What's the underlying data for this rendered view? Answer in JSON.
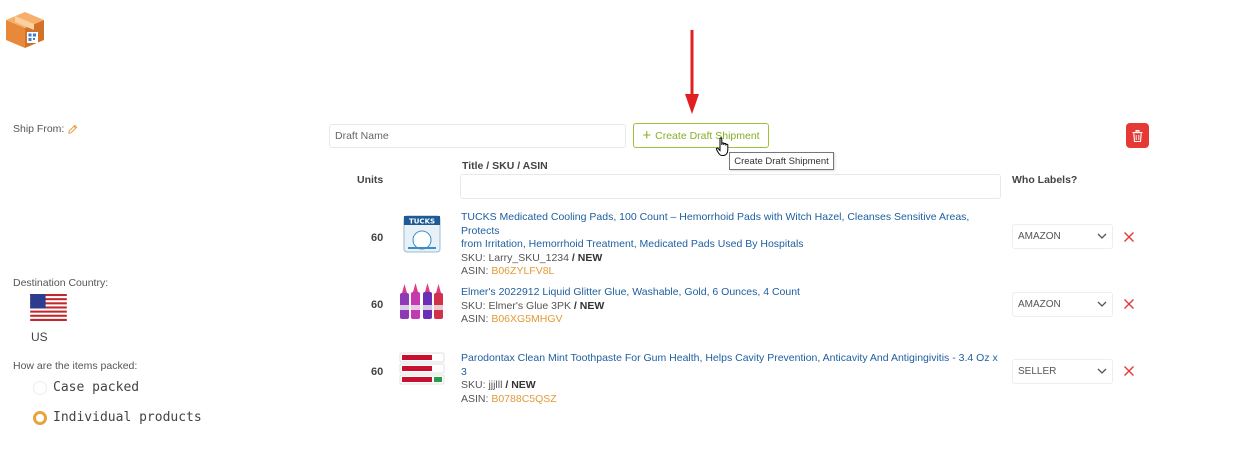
{
  "ship_from": {
    "label": "Ship From:"
  },
  "destination": {
    "label": "Destination Country:",
    "country_code": "US"
  },
  "packing": {
    "label": "How are the items packed:",
    "options": [
      {
        "label": "Case packed",
        "selected": false
      },
      {
        "label": "Individual products",
        "selected": true
      }
    ]
  },
  "draft": {
    "placeholder": "Draft Name",
    "create_label": "Create Draft Shipment",
    "tooltip": "Create Draft Shipment"
  },
  "table": {
    "headers": {
      "units": "Units",
      "title": "Title / SKU / ASIN",
      "who_labels": "Who Labels?"
    },
    "rows": [
      {
        "units": "60",
        "title_line1": "TUCKS Medicated Cooling Pads, 100 Count – Hemorrhoid Pads with Witch Hazel, Cleanses Sensitive Areas, Protects",
        "title_line2": "from Irritation, Hemorrhoid Treatment, Medicated Pads Used By Hospitals",
        "sku_prefix": "SKU: ",
        "sku": "Larry_SKU_1234",
        "condition": " / NEW",
        "asin_prefix": "ASIN: ",
        "asin": "B06ZYLFV8L",
        "who_labels": "AMAZON",
        "thumb_icon": "tucks-product-icon"
      },
      {
        "units": "60",
        "title_line1": "Elmer's 2022912 Liquid Glitter Glue, Washable, Gold, 6 Ounces, 4 Count",
        "title_line2": "",
        "sku_prefix": "SKU: ",
        "sku": "Elmer's Glue 3PK",
        "condition": " / NEW",
        "asin_prefix": "ASIN: ",
        "asin": "B06XG5MHGV",
        "who_labels": "AMAZON",
        "thumb_icon": "glitter-glue-product-icon"
      },
      {
        "units": "60",
        "title_line1": "Parodontax Clean Mint Toothpaste For Gum Health, Helps Cavity Prevention, Anticavity And Antigingivitis - 3.4 Oz x 3",
        "title_line2": "",
        "sku_prefix": "SKU: ",
        "sku": "jjjlll",
        "condition": " / NEW",
        "asin_prefix": "ASIN: ",
        "asin": "B0788C5QSZ",
        "who_labels": "SELLER",
        "thumb_icon": "toothpaste-product-icon"
      }
    ]
  },
  "colors": {
    "accent_green": "#86b024",
    "danger_red": "#e53935",
    "asin_orange": "#e39a35",
    "link_blue": "#1f5fa0"
  }
}
